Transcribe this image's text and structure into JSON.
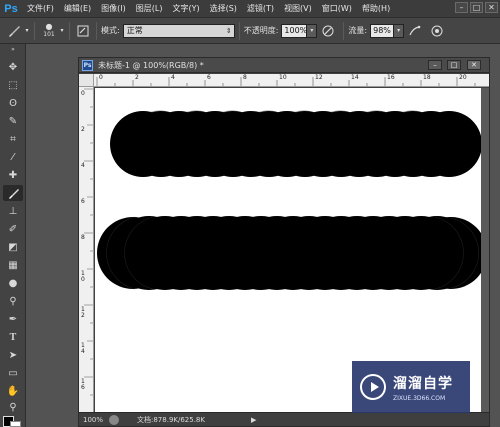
{
  "menubar": {
    "logo": "Ps",
    "items": [
      "文件(F)",
      "编辑(E)",
      "图像(I)",
      "图层(L)",
      "文字(Y)",
      "选择(S)",
      "滤镜(T)",
      "视图(V)",
      "窗口(W)",
      "帮助(H)"
    ]
  },
  "options": {
    "brush_size": "101",
    "mode_label": "模式:",
    "mode_value": "正常",
    "opacity_label": "不透明度:",
    "opacity_value": "100%",
    "flow_label": "流量:",
    "flow_value": "98%"
  },
  "document": {
    "title": "未标题-1 @ 100%(RGB/8) *",
    "ps_badge": "Ps",
    "ruler_top": [
      "0",
      "2",
      "4",
      "6",
      "8",
      "10",
      "12",
      "14",
      "16",
      "18",
      "20"
    ],
    "ruler_left": [
      "0",
      "2",
      "4",
      "6",
      "8",
      "1 0",
      "1 2",
      "1 4",
      "1 6"
    ]
  },
  "status": {
    "zoom": "100%",
    "doc_info": "文档:878.9K/625.8K"
  },
  "watermark": {
    "name": "溜溜自学",
    "url": "ZIXUE.3D66.COM"
  },
  "colors": {
    "foreground": "#000000",
    "background": "#ffffff",
    "ps_blue": "#31a8ff"
  },
  "icons": [
    "brush-icon",
    "move-icon",
    "marquee-icon",
    "lasso-icon",
    "quick-select-icon",
    "crop-icon",
    "eyedropper-icon",
    "healing-icon",
    "brush-tool-icon",
    "clone-stamp-icon",
    "history-brush-icon",
    "eraser-icon",
    "gradient-icon",
    "blur-icon",
    "dodge-icon",
    "pen-icon",
    "type-icon",
    "path-select-icon",
    "shape-icon",
    "hand-icon",
    "zoom-icon"
  ]
}
